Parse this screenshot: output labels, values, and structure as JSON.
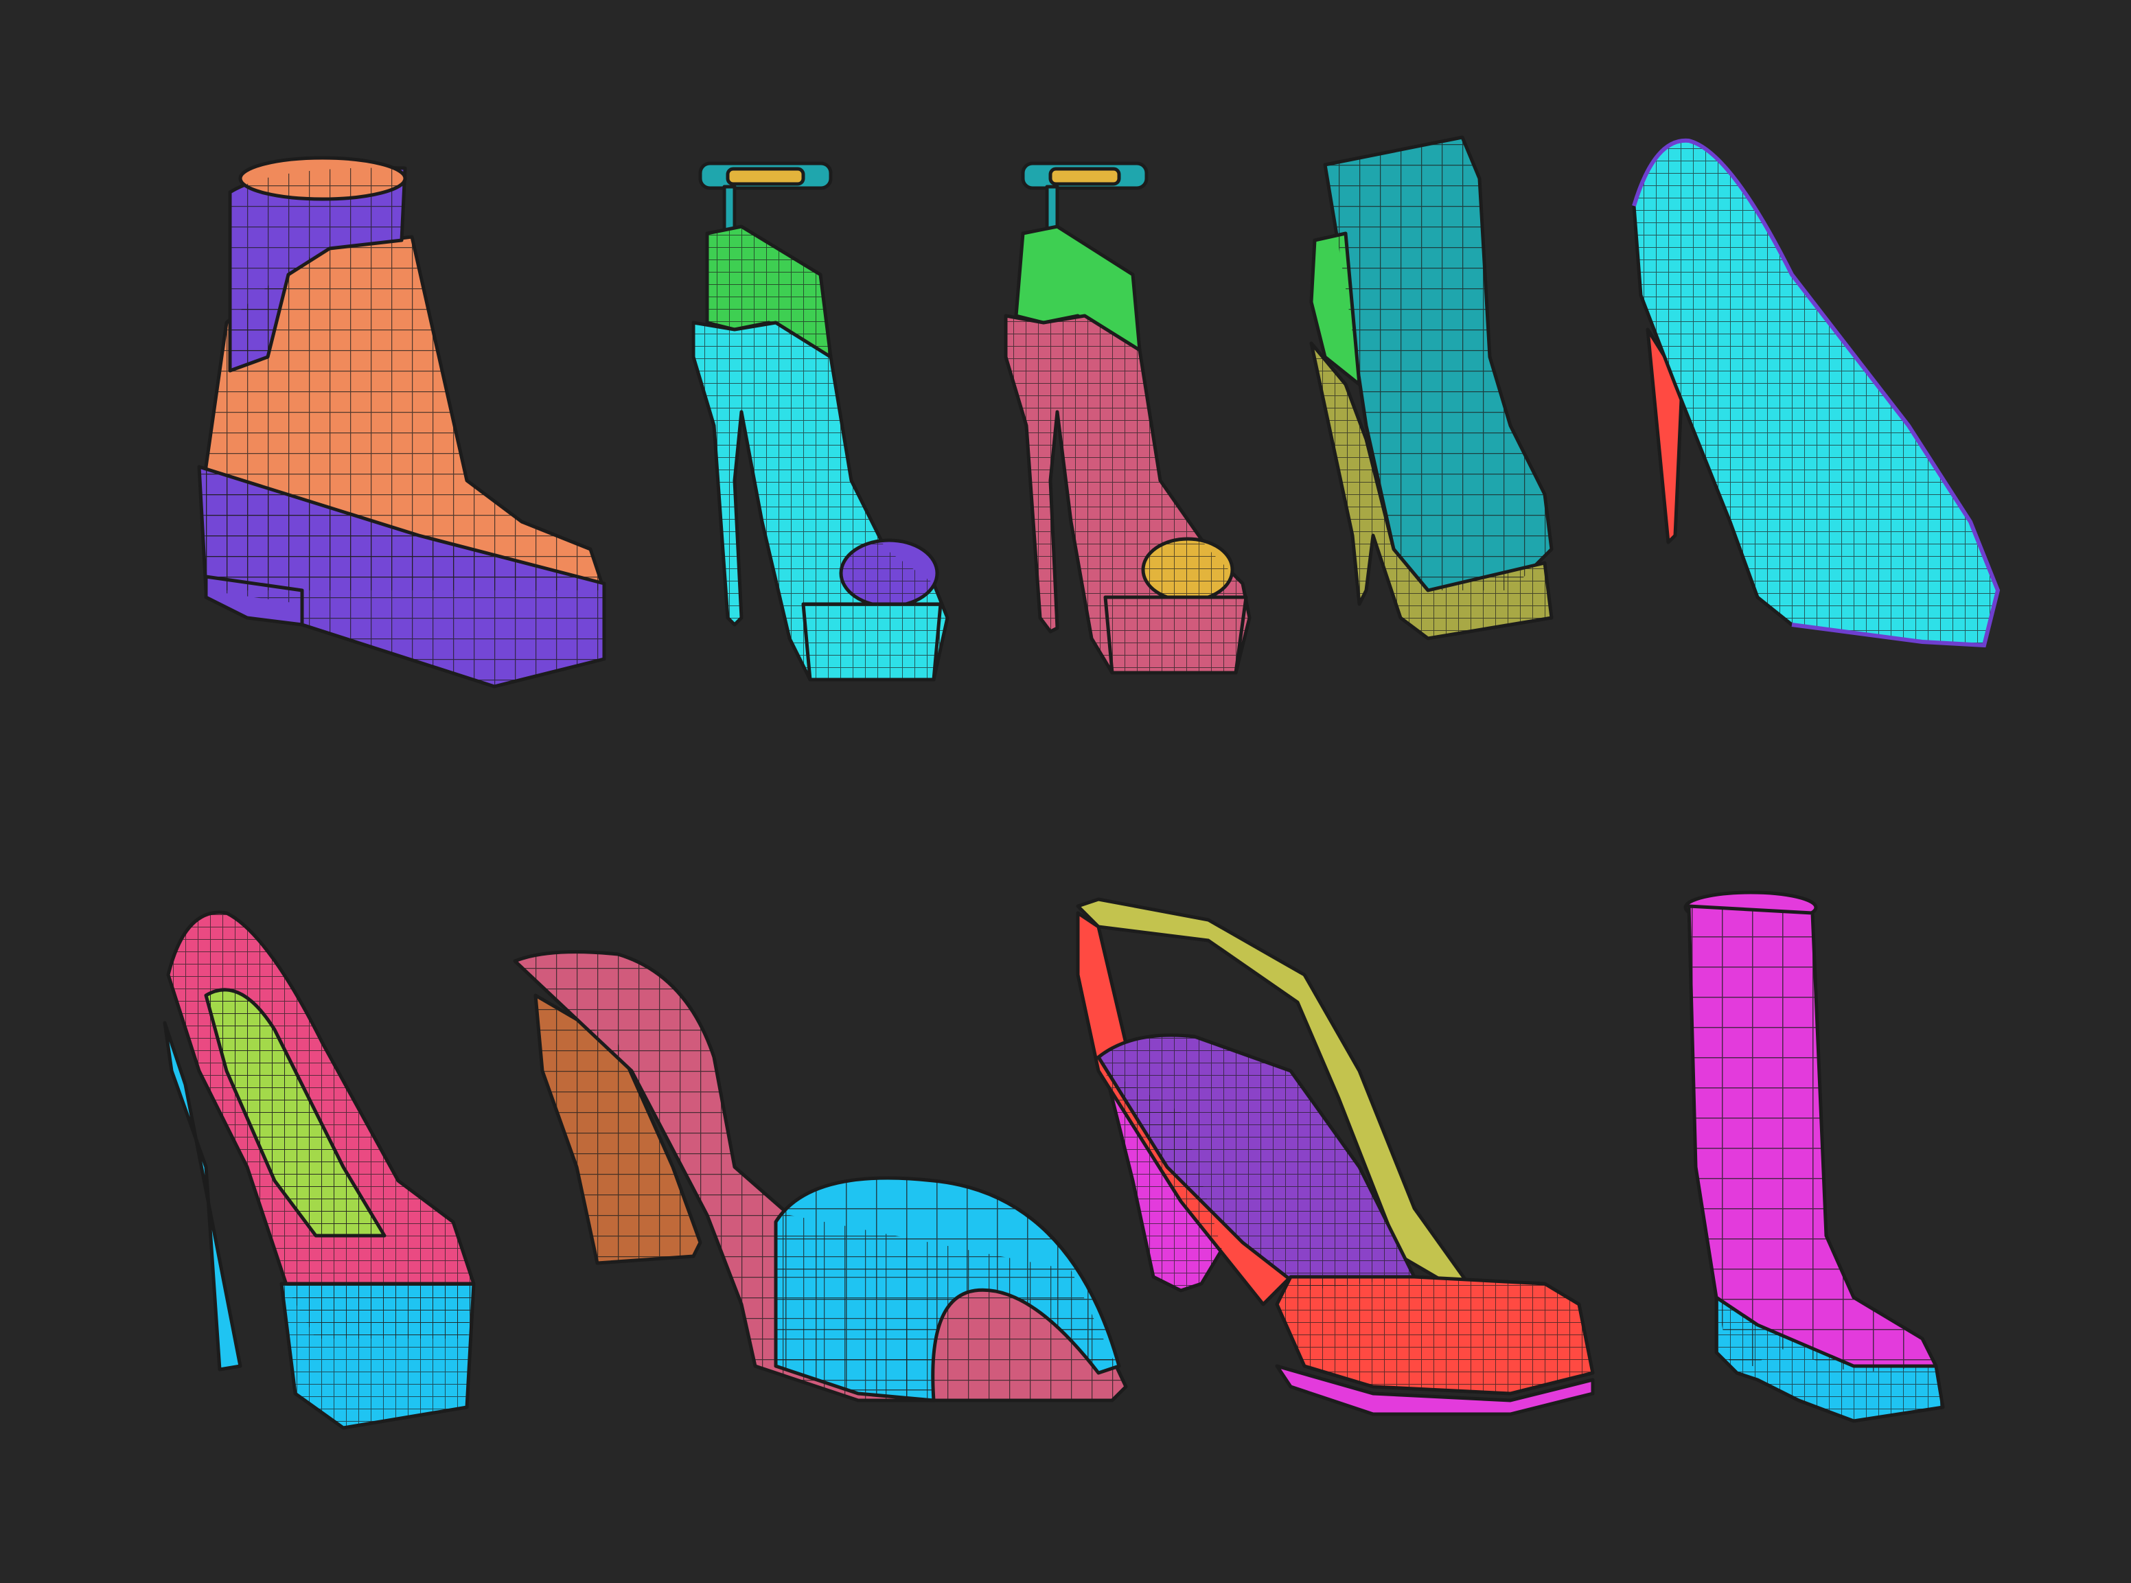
{
  "scene": {
    "background": "#272727",
    "wire_color": "#1c1c1c",
    "polygroup_palette": {
      "orange": "#f08a5b",
      "purple": "#7447d6",
      "cyan": "#2ee0e8",
      "sky": "#1fc4f2",
      "green": "#3ecf52",
      "yellow": "#e3b43c",
      "rose": "#d15b7c",
      "pink": "#ea4a82",
      "magenta": "#e33bdc",
      "olive": "#a8a845",
      "red": "#ff4a42",
      "brown": "#c06a3a",
      "lime": "#a3d94a",
      "teal": "#1fa6ad",
      "violet": "#8b43c8",
      "khaki": "#c3c34e"
    }
  },
  "shoes": [
    {
      "name": "platform-ankle-boot",
      "groups": [
        "orange",
        "purple"
      ]
    },
    {
      "name": "ankle-strap-platform-heel-cyan",
      "groups": [
        "cyan",
        "green",
        "purple",
        "teal"
      ]
    },
    {
      "name": "ankle-strap-platform-heel-rose",
      "groups": [
        "rose",
        "green",
        "yellow",
        "teal"
      ]
    },
    {
      "name": "platform-ankle-bootie-teal",
      "groups": [
        "teal",
        "green",
        "olive"
      ]
    },
    {
      "name": "stiletto-pump-cyan",
      "groups": [
        "cyan",
        "red"
      ]
    },
    {
      "name": "platform-pump-pink",
      "groups": [
        "pink",
        "sky",
        "lime"
      ]
    },
    {
      "name": "peep-toe-mule",
      "groups": [
        "rose",
        "sky",
        "brown"
      ]
    },
    {
      "name": "slingback-heel",
      "groups": [
        "red",
        "violet",
        "magenta",
        "khaki"
      ]
    },
    {
      "name": "rain-boot",
      "groups": [
        "magenta",
        "sky"
      ]
    }
  ]
}
